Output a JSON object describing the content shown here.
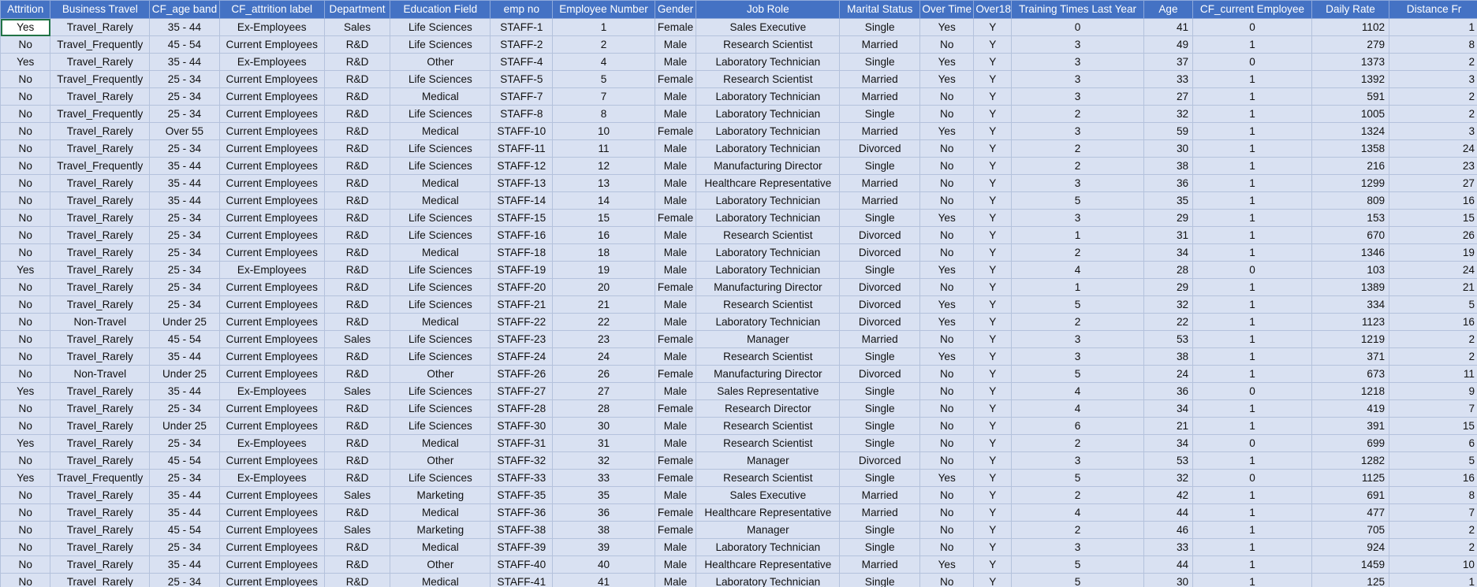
{
  "columns": [
    "Attrition",
    "Business Travel",
    "CF_age band",
    "CF_attrition label",
    "Department",
    "Education Field",
    "emp no",
    "Employee Number",
    "Gender",
    "Job Role",
    "Marital Status",
    "Over Time",
    "Over18",
    "Training Times Last Year",
    "Age",
    "CF_current Employee",
    "Daily Rate",
    "Distance Fr"
  ],
  "active_cell": {
    "row": 0,
    "col": 0
  },
  "rows": [
    [
      "Yes",
      "Travel_Rarely",
      "35 - 44",
      "Ex-Employees",
      "Sales",
      "Life Sciences",
      "STAFF-1",
      "1",
      "Female",
      "Sales Executive",
      "Single",
      "Yes",
      "Y",
      "0",
      "41",
      "0",
      "1102",
      "1"
    ],
    [
      "No",
      "Travel_Frequently",
      "45 - 54",
      "Current Employees",
      "R&D",
      "Life Sciences",
      "STAFF-2",
      "2",
      "Male",
      "Research Scientist",
      "Married",
      "No",
      "Y",
      "3",
      "49",
      "1",
      "279",
      "8"
    ],
    [
      "Yes",
      "Travel_Rarely",
      "35 - 44",
      "Ex-Employees",
      "R&D",
      "Other",
      "STAFF-4",
      "4",
      "Male",
      "Laboratory Technician",
      "Single",
      "Yes",
      "Y",
      "3",
      "37",
      "0",
      "1373",
      "2"
    ],
    [
      "No",
      "Travel_Frequently",
      "25 - 34",
      "Current Employees",
      "R&D",
      "Life Sciences",
      "STAFF-5",
      "5",
      "Female",
      "Research Scientist",
      "Married",
      "Yes",
      "Y",
      "3",
      "33",
      "1",
      "1392",
      "3"
    ],
    [
      "No",
      "Travel_Rarely",
      "25 - 34",
      "Current Employees",
      "R&D",
      "Medical",
      "STAFF-7",
      "7",
      "Male",
      "Laboratory Technician",
      "Married",
      "No",
      "Y",
      "3",
      "27",
      "1",
      "591",
      "2"
    ],
    [
      "No",
      "Travel_Frequently",
      "25 - 34",
      "Current Employees",
      "R&D",
      "Life Sciences",
      "STAFF-8",
      "8",
      "Male",
      "Laboratory Technician",
      "Single",
      "No",
      "Y",
      "2",
      "32",
      "1",
      "1005",
      "2"
    ],
    [
      "No",
      "Travel_Rarely",
      "Over 55",
      "Current Employees",
      "R&D",
      "Medical",
      "STAFF-10",
      "10",
      "Female",
      "Laboratory Technician",
      "Married",
      "Yes",
      "Y",
      "3",
      "59",
      "1",
      "1324",
      "3"
    ],
    [
      "No",
      "Travel_Rarely",
      "25 - 34",
      "Current Employees",
      "R&D",
      "Life Sciences",
      "STAFF-11",
      "11",
      "Male",
      "Laboratory Technician",
      "Divorced",
      "No",
      "Y",
      "2",
      "30",
      "1",
      "1358",
      "24"
    ],
    [
      "No",
      "Travel_Frequently",
      "35 - 44",
      "Current Employees",
      "R&D",
      "Life Sciences",
      "STAFF-12",
      "12",
      "Male",
      "Manufacturing Director",
      "Single",
      "No",
      "Y",
      "2",
      "38",
      "1",
      "216",
      "23"
    ],
    [
      "No",
      "Travel_Rarely",
      "35 - 44",
      "Current Employees",
      "R&D",
      "Medical",
      "STAFF-13",
      "13",
      "Male",
      "Healthcare Representative",
      "Married",
      "No",
      "Y",
      "3",
      "36",
      "1",
      "1299",
      "27"
    ],
    [
      "No",
      "Travel_Rarely",
      "35 - 44",
      "Current Employees",
      "R&D",
      "Medical",
      "STAFF-14",
      "14",
      "Male",
      "Laboratory Technician",
      "Married",
      "No",
      "Y",
      "5",
      "35",
      "1",
      "809",
      "16"
    ],
    [
      "No",
      "Travel_Rarely",
      "25 - 34",
      "Current Employees",
      "R&D",
      "Life Sciences",
      "STAFF-15",
      "15",
      "Female",
      "Laboratory Technician",
      "Single",
      "Yes",
      "Y",
      "3",
      "29",
      "1",
      "153",
      "15"
    ],
    [
      "No",
      "Travel_Rarely",
      "25 - 34",
      "Current Employees",
      "R&D",
      "Life Sciences",
      "STAFF-16",
      "16",
      "Male",
      "Research Scientist",
      "Divorced",
      "No",
      "Y",
      "1",
      "31",
      "1",
      "670",
      "26"
    ],
    [
      "No",
      "Travel_Rarely",
      "25 - 34",
      "Current Employees",
      "R&D",
      "Medical",
      "STAFF-18",
      "18",
      "Male",
      "Laboratory Technician",
      "Divorced",
      "No",
      "Y",
      "2",
      "34",
      "1",
      "1346",
      "19"
    ],
    [
      "Yes",
      "Travel_Rarely",
      "25 - 34",
      "Ex-Employees",
      "R&D",
      "Life Sciences",
      "STAFF-19",
      "19",
      "Male",
      "Laboratory Technician",
      "Single",
      "Yes",
      "Y",
      "4",
      "28",
      "0",
      "103",
      "24"
    ],
    [
      "No",
      "Travel_Rarely",
      "25 - 34",
      "Current Employees",
      "R&D",
      "Life Sciences",
      "STAFF-20",
      "20",
      "Female",
      "Manufacturing Director",
      "Divorced",
      "No",
      "Y",
      "1",
      "29",
      "1",
      "1389",
      "21"
    ],
    [
      "No",
      "Travel_Rarely",
      "25 - 34",
      "Current Employees",
      "R&D",
      "Life Sciences",
      "STAFF-21",
      "21",
      "Male",
      "Research Scientist",
      "Divorced",
      "Yes",
      "Y",
      "5",
      "32",
      "1",
      "334",
      "5"
    ],
    [
      "No",
      "Non-Travel",
      "Under 25",
      "Current Employees",
      "R&D",
      "Medical",
      "STAFF-22",
      "22",
      "Male",
      "Laboratory Technician",
      "Divorced",
      "Yes",
      "Y",
      "2",
      "22",
      "1",
      "1123",
      "16"
    ],
    [
      "No",
      "Travel_Rarely",
      "45 - 54",
      "Current Employees",
      "Sales",
      "Life Sciences",
      "STAFF-23",
      "23",
      "Female",
      "Manager",
      "Married",
      "No",
      "Y",
      "3",
      "53",
      "1",
      "1219",
      "2"
    ],
    [
      "No",
      "Travel_Rarely",
      "35 - 44",
      "Current Employees",
      "R&D",
      "Life Sciences",
      "STAFF-24",
      "24",
      "Male",
      "Research Scientist",
      "Single",
      "Yes",
      "Y",
      "3",
      "38",
      "1",
      "371",
      "2"
    ],
    [
      "No",
      "Non-Travel",
      "Under 25",
      "Current Employees",
      "R&D",
      "Other",
      "STAFF-26",
      "26",
      "Female",
      "Manufacturing Director",
      "Divorced",
      "No",
      "Y",
      "5",
      "24",
      "1",
      "673",
      "11"
    ],
    [
      "Yes",
      "Travel_Rarely",
      "35 - 44",
      "Ex-Employees",
      "Sales",
      "Life Sciences",
      "STAFF-27",
      "27",
      "Male",
      "Sales Representative",
      "Single",
      "No",
      "Y",
      "4",
      "36",
      "0",
      "1218",
      "9"
    ],
    [
      "No",
      "Travel_Rarely",
      "25 - 34",
      "Current Employees",
      "R&D",
      "Life Sciences",
      "STAFF-28",
      "28",
      "Female",
      "Research Director",
      "Single",
      "No",
      "Y",
      "4",
      "34",
      "1",
      "419",
      "7"
    ],
    [
      "No",
      "Travel_Rarely",
      "Under 25",
      "Current Employees",
      "R&D",
      "Life Sciences",
      "STAFF-30",
      "30",
      "Male",
      "Research Scientist",
      "Single",
      "No",
      "Y",
      "6",
      "21",
      "1",
      "391",
      "15"
    ],
    [
      "Yes",
      "Travel_Rarely",
      "25 - 34",
      "Ex-Employees",
      "R&D",
      "Medical",
      "STAFF-31",
      "31",
      "Male",
      "Research Scientist",
      "Single",
      "No",
      "Y",
      "2",
      "34",
      "0",
      "699",
      "6"
    ],
    [
      "No",
      "Travel_Rarely",
      "45 - 54",
      "Current Employees",
      "R&D",
      "Other",
      "STAFF-32",
      "32",
      "Female",
      "Manager",
      "Divorced",
      "No",
      "Y",
      "3",
      "53",
      "1",
      "1282",
      "5"
    ],
    [
      "Yes",
      "Travel_Frequently",
      "25 - 34",
      "Ex-Employees",
      "R&D",
      "Life Sciences",
      "STAFF-33",
      "33",
      "Female",
      "Research Scientist",
      "Single",
      "Yes",
      "Y",
      "5",
      "32",
      "0",
      "1125",
      "16"
    ],
    [
      "No",
      "Travel_Rarely",
      "35 - 44",
      "Current Employees",
      "Sales",
      "Marketing",
      "STAFF-35",
      "35",
      "Male",
      "Sales Executive",
      "Married",
      "No",
      "Y",
      "2",
      "42",
      "1",
      "691",
      "8"
    ],
    [
      "No",
      "Travel_Rarely",
      "35 - 44",
      "Current Employees",
      "R&D",
      "Medical",
      "STAFF-36",
      "36",
      "Female",
      "Healthcare Representative",
      "Married",
      "No",
      "Y",
      "4",
      "44",
      "1",
      "477",
      "7"
    ],
    [
      "No",
      "Travel_Rarely",
      "45 - 54",
      "Current Employees",
      "Sales",
      "Marketing",
      "STAFF-38",
      "38",
      "Female",
      "Manager",
      "Single",
      "No",
      "Y",
      "2",
      "46",
      "1",
      "705",
      "2"
    ],
    [
      "No",
      "Travel_Rarely",
      "25 - 34",
      "Current Employees",
      "R&D",
      "Medical",
      "STAFF-39",
      "39",
      "Male",
      "Laboratory Technician",
      "Single",
      "No",
      "Y",
      "3",
      "33",
      "1",
      "924",
      "2"
    ],
    [
      "No",
      "Travel_Rarely",
      "35 - 44",
      "Current Employees",
      "R&D",
      "Other",
      "STAFF-40",
      "40",
      "Male",
      "Healthcare Representative",
      "Married",
      "Yes",
      "Y",
      "5",
      "44",
      "1",
      "1459",
      "10"
    ],
    [
      "No",
      "Travel_Rarely",
      "25 - 34",
      "Current Employees",
      "R&D",
      "Medical",
      "STAFF-41",
      "41",
      "Male",
      "Laboratory Technician",
      "Single",
      "No",
      "Y",
      "5",
      "30",
      "1",
      "125",
      "1"
    ]
  ]
}
